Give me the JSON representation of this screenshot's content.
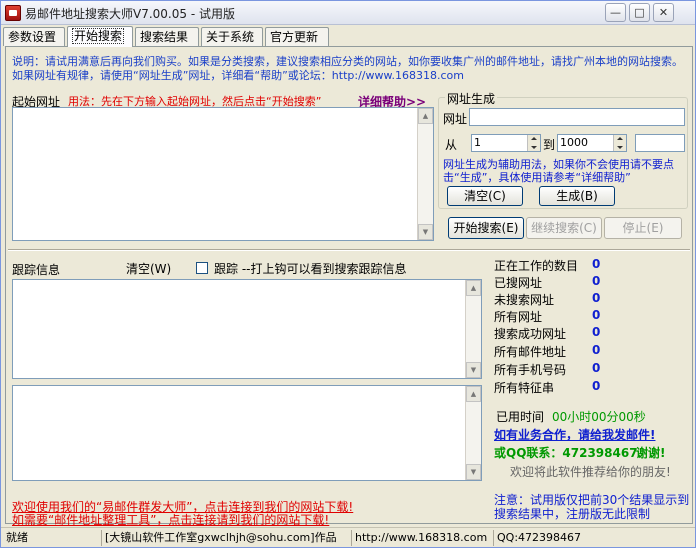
{
  "window": {
    "title": "易邮件地址搜索大师V7.00.05 - 试用版",
    "min_symbol": "—",
    "max_symbol": "□",
    "close_symbol": "✕"
  },
  "tabs": [
    "参数设置",
    "开始搜索",
    "搜索结果",
    "关于系统",
    "官方更新"
  ],
  "notice": "说明：请试用满意后再向我们购买。如果是分类搜索，建议搜索相应分类的网站，如你要收集广州的邮件地址，请找广州本地的网站搜索。如果网址有规律，请使用“网址生成”网址，详细看“帮助”或论坛：http://www.168318.com",
  "start_url": {
    "label": "起始网址",
    "usage": "用法：先在下方输入起始网址，然后点击“开始搜索”",
    "help_link": "详细帮助>>"
  },
  "url_gen": {
    "title": "网址生成",
    "url_label": "网址",
    "url_value": "",
    "from_label": "从",
    "from_value": "1",
    "to_label": "到",
    "to_value": "1000",
    "extra_value": "",
    "note": "网址生成为辅助用法，如果你不会使用请不要点击“生成”，具体使用请参考“详细帮助”",
    "clear_btn": "清空(C)",
    "generate_btn": "生成(B)"
  },
  "actions": {
    "start": "开始搜索(E)",
    "continue": "继续搜索(C)",
    "stop": "停止(E)"
  },
  "trace": {
    "label": "跟踪信息",
    "clear": "清空(W)",
    "checkbox_label": "跟踪 --打上钩可以看到搜索跟踪信息"
  },
  "stats": [
    {
      "label": "正在工作的数目",
      "value": "0"
    },
    {
      "label": "已搜网址",
      "value": "0"
    },
    {
      "label": "未搜索网址",
      "value": "0"
    },
    {
      "label": "所有网址",
      "value": "0"
    },
    {
      "label": "搜索成功网址",
      "value": "0"
    },
    {
      "label": "所有邮件地址",
      "value": "0"
    },
    {
      "label": "所有手机号码",
      "value": "0"
    },
    {
      "label": "所有特征串",
      "value": "0"
    }
  ],
  "elapsed": {
    "label": "已用时间",
    "value": "00小时00分00秒"
  },
  "contact": {
    "business": "如有业务合作，请给我发邮件!",
    "qq": "或QQ联系：472398467",
    "thanks": "谢谢!",
    "recommend": "欢迎将此软件推荐给你的朋友!"
  },
  "promo": {
    "line1": "欢迎使用我们的“易邮件群发大师”，点击连接到我们的网站下载!",
    "line2": "如需要“邮件地址整理工具”，点击连接请到我们的网站下载!"
  },
  "trial_note": "注意：试用版仅把前30个结果显示到搜索结果中，注册版无此限制",
  "statusbar": {
    "ready": "就绪",
    "author": "[大镜山软件工作室gxwclhjh@sohu.com]作品",
    "site": "http://www.168318.com",
    "qq": "QQ:472398467"
  }
}
